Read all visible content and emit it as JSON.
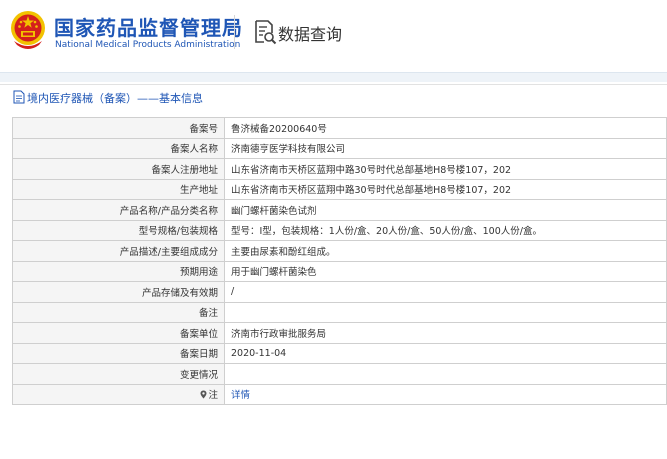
{
  "header": {
    "org_name_cn": "国家药品监督管理局",
    "org_name_en": "National Medical Products Administration",
    "section_title": "数据查询",
    "emblem_icon": "national-emblem-icon",
    "query_icon": "document-search-icon"
  },
  "breadcrumb": {
    "icon": "document-icon",
    "text": "境内医疗器械（备案）——基本信息"
  },
  "record": {
    "rows": [
      {
        "label": "备案号",
        "value": "鲁济械备20200640号"
      },
      {
        "label": "备案人名称",
        "value": "济南德亨医学科技有限公司"
      },
      {
        "label": "备案人注册地址",
        "value": "山东省济南市天桥区蓝翔中路30号时代总部基地H8号楼107，202"
      },
      {
        "label": "生产地址",
        "value": "山东省济南市天桥区蓝翔中路30号时代总部基地H8号楼107，202"
      },
      {
        "label": "产品名称/产品分类名称",
        "value": "幽门螺杆菌染色试剂"
      },
      {
        "label": "型号规格/包装规格",
        "value": "型号：Ⅰ型，包装规格：1人份/盒、20人份/盒、50人份/盒、100人份/盒。"
      },
      {
        "label": "产品描述/主要组成成分",
        "value": "主要由尿素和酚红组成。"
      },
      {
        "label": "预期用途",
        "value": "用于幽门螺杆菌染色"
      },
      {
        "label": "产品存储及有效期",
        "value": "/"
      },
      {
        "label": "备注",
        "value": ""
      },
      {
        "label": "备案单位",
        "value": "济南市行政审批服务局"
      },
      {
        "label": "备案日期",
        "value": "2020-11-04"
      },
      {
        "label": "变更情况",
        "value": ""
      }
    ],
    "note_row": {
      "label": "注",
      "icon": "map-pin-icon",
      "link_text": "详情"
    }
  },
  "colors": {
    "brand_blue": "#1f56b5",
    "emblem_red": "#d4201c",
    "emblem_gold": "#f2c200",
    "label_bg": "#f5f5f5",
    "border": "#cfcfcf"
  }
}
